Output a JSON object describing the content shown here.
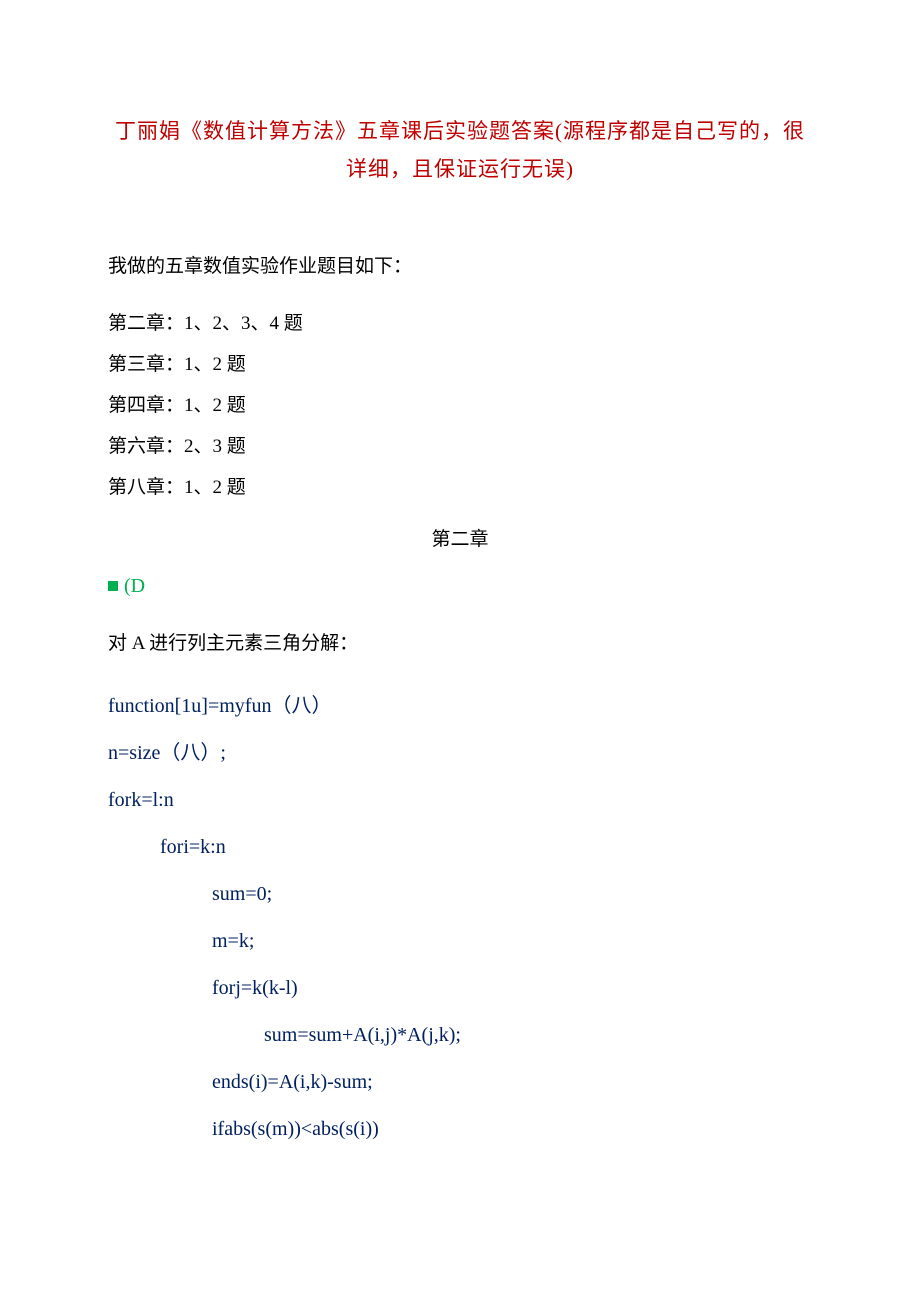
{
  "title": {
    "line1": "丁丽娟《数值计算方法》五章课后实验题答案(源程序都是自己写的，很",
    "line2": "详细，且保证运行无误)"
  },
  "intro": "我做的五章数值实验作业题目如下：",
  "chapters": [
    "第二章：1、2、3、4 题",
    "第三章：1、2 题",
    "第四章：1、2 题",
    "第六章：2、3 题",
    "第八章：1、2 题"
  ],
  "section_header": "第二章",
  "marker": "(D",
  "subheading": "对 A 进行列主元素三角分解：",
  "code": [
    {
      "text": "function[1u]=myfun（八）",
      "indent": 0
    },
    {
      "text": "n=size（八）;",
      "indent": 0
    },
    {
      "text": "fork=l:n",
      "indent": 0
    },
    {
      "text": "fori=k:n",
      "indent": 1
    },
    {
      "text": "sum=0;",
      "indent": 2
    },
    {
      "text": "m=k;",
      "indent": 2
    },
    {
      "text": "forj=k(k-l)",
      "indent": 2
    },
    {
      "text": "sum=sum+A(i,j)*A(j,k);",
      "indent": 3
    },
    {
      "text": "ends(i)=A(i,k)-sum;",
      "indent": 2
    },
    {
      "text": "ifabs(s(m))<abs(s(i))",
      "indent": 2
    }
  ]
}
